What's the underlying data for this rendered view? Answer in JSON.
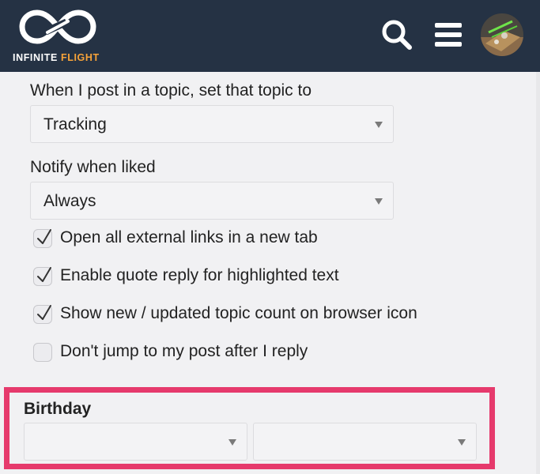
{
  "header": {
    "logo_word1": "INFINITE",
    "logo_word2": "FLIGHT",
    "search_icon": "search-icon",
    "menu_icon": "hamburger-menu-icon",
    "avatar": "user-avatar"
  },
  "preferences": {
    "post_topic_label": "When I post in a topic, set that topic to",
    "post_topic_value": "Tracking",
    "notify_liked_label": "Notify when liked",
    "notify_liked_value": "Always",
    "checkboxes": [
      {
        "label": "Open all external links in a new tab",
        "checked": true
      },
      {
        "label": "Enable quote reply for highlighted text",
        "checked": true
      },
      {
        "label": "Show new / updated topic count on browser icon",
        "checked": true
      },
      {
        "label": "Don't jump to my post after I reply",
        "checked": false
      }
    ]
  },
  "birthday": {
    "label": "Birthday",
    "month_value": "",
    "day_value": ""
  },
  "colors": {
    "header_bg": "#253244",
    "brand_orange": "#f7a339",
    "highlight_border": "#e63a6c",
    "page_bg": "#f1f1f3"
  }
}
